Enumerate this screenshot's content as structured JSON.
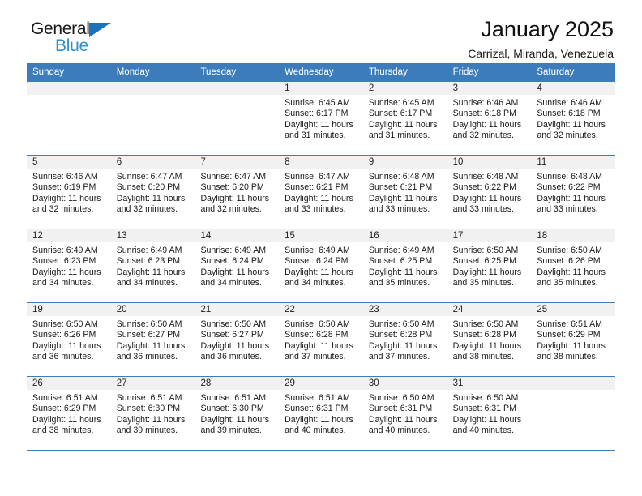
{
  "brand": {
    "name_top": "General",
    "name_bottom": "Blue",
    "accent_color": "#1b72bc",
    "accent_light": "#2d8fd5"
  },
  "header": {
    "title": "January 2025",
    "subtitle": "Carrizal, Miranda, Venezuela"
  },
  "theme": {
    "header_row_bg": "#3d7cba",
    "daynum_band_bg": "#f1f1f1",
    "grid_line": "#3d7cba",
    "text": "#1a1a1a"
  },
  "weekdays": [
    "Sunday",
    "Monday",
    "Tuesday",
    "Wednesday",
    "Thursday",
    "Friday",
    "Saturday"
  ],
  "labels": {
    "sunrise": "Sunrise:",
    "sunset": "Sunset:",
    "daylight": "Daylight:"
  },
  "weeks": [
    [
      {
        "day": "",
        "blank": true
      },
      {
        "day": "",
        "blank": true
      },
      {
        "day": "",
        "blank": true
      },
      {
        "day": "1",
        "sunrise": "Sunrise: 6:45 AM",
        "sunset": "Sunset: 6:17 PM",
        "daylight": "Daylight: 11 hours and 31 minutes."
      },
      {
        "day": "2",
        "sunrise": "Sunrise: 6:45 AM",
        "sunset": "Sunset: 6:17 PM",
        "daylight": "Daylight: 11 hours and 31 minutes."
      },
      {
        "day": "3",
        "sunrise": "Sunrise: 6:46 AM",
        "sunset": "Sunset: 6:18 PM",
        "daylight": "Daylight: 11 hours and 32 minutes."
      },
      {
        "day": "4",
        "sunrise": "Sunrise: 6:46 AM",
        "sunset": "Sunset: 6:18 PM",
        "daylight": "Daylight: 11 hours and 32 minutes."
      }
    ],
    [
      {
        "day": "5",
        "sunrise": "Sunrise: 6:46 AM",
        "sunset": "Sunset: 6:19 PM",
        "daylight": "Daylight: 11 hours and 32 minutes."
      },
      {
        "day": "6",
        "sunrise": "Sunrise: 6:47 AM",
        "sunset": "Sunset: 6:20 PM",
        "daylight": "Daylight: 11 hours and 32 minutes."
      },
      {
        "day": "7",
        "sunrise": "Sunrise: 6:47 AM",
        "sunset": "Sunset: 6:20 PM",
        "daylight": "Daylight: 11 hours and 32 minutes."
      },
      {
        "day": "8",
        "sunrise": "Sunrise: 6:47 AM",
        "sunset": "Sunset: 6:21 PM",
        "daylight": "Daylight: 11 hours and 33 minutes."
      },
      {
        "day": "9",
        "sunrise": "Sunrise: 6:48 AM",
        "sunset": "Sunset: 6:21 PM",
        "daylight": "Daylight: 11 hours and 33 minutes."
      },
      {
        "day": "10",
        "sunrise": "Sunrise: 6:48 AM",
        "sunset": "Sunset: 6:22 PM",
        "daylight": "Daylight: 11 hours and 33 minutes."
      },
      {
        "day": "11",
        "sunrise": "Sunrise: 6:48 AM",
        "sunset": "Sunset: 6:22 PM",
        "daylight": "Daylight: 11 hours and 33 minutes."
      }
    ],
    [
      {
        "day": "12",
        "sunrise": "Sunrise: 6:49 AM",
        "sunset": "Sunset: 6:23 PM",
        "daylight": "Daylight: 11 hours and 34 minutes."
      },
      {
        "day": "13",
        "sunrise": "Sunrise: 6:49 AM",
        "sunset": "Sunset: 6:23 PM",
        "daylight": "Daylight: 11 hours and 34 minutes."
      },
      {
        "day": "14",
        "sunrise": "Sunrise: 6:49 AM",
        "sunset": "Sunset: 6:24 PM",
        "daylight": "Daylight: 11 hours and 34 minutes."
      },
      {
        "day": "15",
        "sunrise": "Sunrise: 6:49 AM",
        "sunset": "Sunset: 6:24 PM",
        "daylight": "Daylight: 11 hours and 34 minutes."
      },
      {
        "day": "16",
        "sunrise": "Sunrise: 6:49 AM",
        "sunset": "Sunset: 6:25 PM",
        "daylight": "Daylight: 11 hours and 35 minutes."
      },
      {
        "day": "17",
        "sunrise": "Sunrise: 6:50 AM",
        "sunset": "Sunset: 6:25 PM",
        "daylight": "Daylight: 11 hours and 35 minutes."
      },
      {
        "day": "18",
        "sunrise": "Sunrise: 6:50 AM",
        "sunset": "Sunset: 6:26 PM",
        "daylight": "Daylight: 11 hours and 35 minutes."
      }
    ],
    [
      {
        "day": "19",
        "sunrise": "Sunrise: 6:50 AM",
        "sunset": "Sunset: 6:26 PM",
        "daylight": "Daylight: 11 hours and 36 minutes."
      },
      {
        "day": "20",
        "sunrise": "Sunrise: 6:50 AM",
        "sunset": "Sunset: 6:27 PM",
        "daylight": "Daylight: 11 hours and 36 minutes."
      },
      {
        "day": "21",
        "sunrise": "Sunrise: 6:50 AM",
        "sunset": "Sunset: 6:27 PM",
        "daylight": "Daylight: 11 hours and 36 minutes."
      },
      {
        "day": "22",
        "sunrise": "Sunrise: 6:50 AM",
        "sunset": "Sunset: 6:28 PM",
        "daylight": "Daylight: 11 hours and 37 minutes."
      },
      {
        "day": "23",
        "sunrise": "Sunrise: 6:50 AM",
        "sunset": "Sunset: 6:28 PM",
        "daylight": "Daylight: 11 hours and 37 minutes."
      },
      {
        "day": "24",
        "sunrise": "Sunrise: 6:50 AM",
        "sunset": "Sunset: 6:28 PM",
        "daylight": "Daylight: 11 hours and 38 minutes."
      },
      {
        "day": "25",
        "sunrise": "Sunrise: 6:51 AM",
        "sunset": "Sunset: 6:29 PM",
        "daylight": "Daylight: 11 hours and 38 minutes."
      }
    ],
    [
      {
        "day": "26",
        "sunrise": "Sunrise: 6:51 AM",
        "sunset": "Sunset: 6:29 PM",
        "daylight": "Daylight: 11 hours and 38 minutes."
      },
      {
        "day": "27",
        "sunrise": "Sunrise: 6:51 AM",
        "sunset": "Sunset: 6:30 PM",
        "daylight": "Daylight: 11 hours and 39 minutes."
      },
      {
        "day": "28",
        "sunrise": "Sunrise: 6:51 AM",
        "sunset": "Sunset: 6:30 PM",
        "daylight": "Daylight: 11 hours and 39 minutes."
      },
      {
        "day": "29",
        "sunrise": "Sunrise: 6:51 AM",
        "sunset": "Sunset: 6:31 PM",
        "daylight": "Daylight: 11 hours and 40 minutes."
      },
      {
        "day": "30",
        "sunrise": "Sunrise: 6:50 AM",
        "sunset": "Sunset: 6:31 PM",
        "daylight": "Daylight: 11 hours and 40 minutes."
      },
      {
        "day": "31",
        "sunrise": "Sunrise: 6:50 AM",
        "sunset": "Sunset: 6:31 PM",
        "daylight": "Daylight: 11 hours and 40 minutes."
      },
      {
        "day": "",
        "blank": true
      }
    ]
  ]
}
